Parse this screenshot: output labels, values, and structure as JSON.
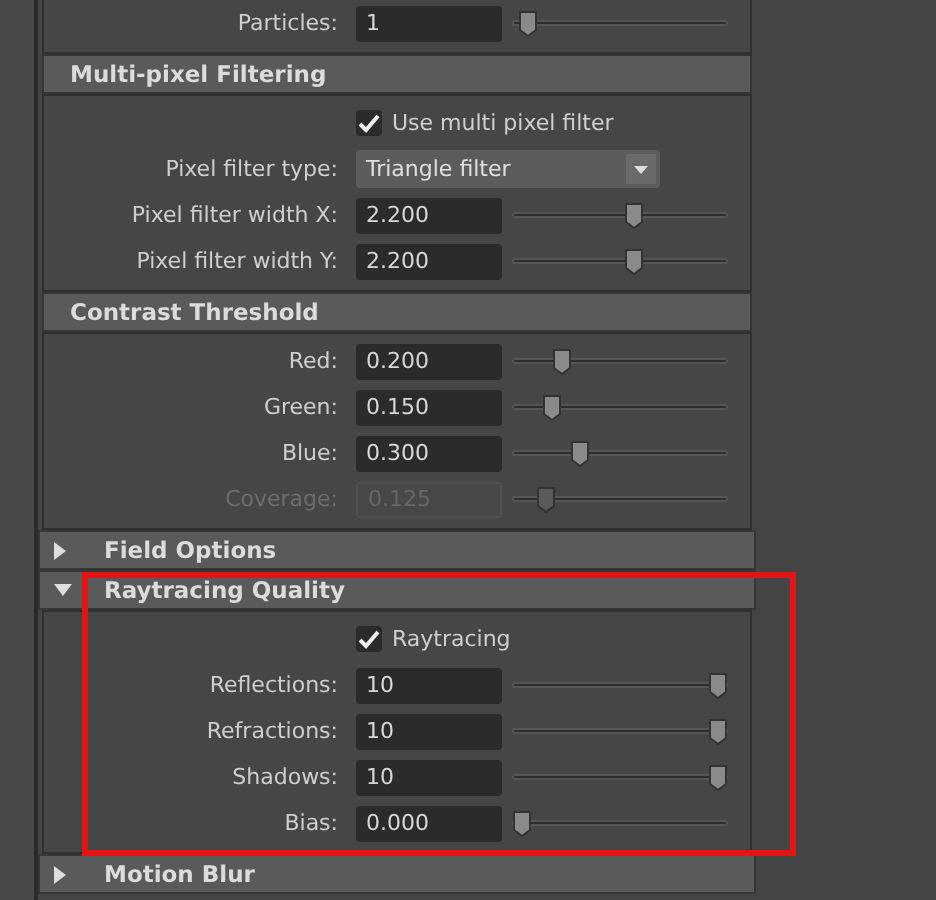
{
  "sections": [
    {
      "kind": "subsection",
      "rows": [
        {
          "kind": "slider",
          "label": "Particles:",
          "value": "1",
          "level": 0.03,
          "disabled": false
        }
      ]
    },
    {
      "kind": "subsection",
      "title": "Multi-pixel Filtering",
      "rows": [
        {
          "kind": "checkbox",
          "label": "Use multi pixel filter",
          "checked": true
        },
        {
          "kind": "dropdown",
          "label": "Pixel filter type:",
          "value": "Triangle filter"
        },
        {
          "kind": "slider",
          "label": "Pixel filter width X:",
          "value": "2.200",
          "level": 0.57,
          "disabled": false
        },
        {
          "kind": "slider",
          "label": "Pixel filter width Y:",
          "value": "2.200",
          "level": 0.57,
          "disabled": false
        }
      ]
    },
    {
      "kind": "subsection",
      "title": "Contrast Threshold",
      "rows": [
        {
          "kind": "slider",
          "label": "Red:",
          "value": "0.200",
          "level": 0.2,
          "disabled": false
        },
        {
          "kind": "slider",
          "label": "Green:",
          "value": "0.150",
          "level": 0.15,
          "disabled": false
        },
        {
          "kind": "slider",
          "label": "Blue:",
          "value": "0.300",
          "level": 0.3,
          "disabled": false
        },
        {
          "kind": "slider",
          "label": "Coverage:",
          "value": "0.125",
          "level": 0.125,
          "disabled": true
        }
      ]
    },
    {
      "kind": "section",
      "title": "Field Options",
      "expanded": false,
      "highlighted": false
    },
    {
      "kind": "section",
      "title": "Raytracing Quality",
      "expanded": true,
      "highlighted": true,
      "rows": [
        {
          "kind": "checkbox",
          "label": "Raytracing",
          "checked": true
        },
        {
          "kind": "slider",
          "label": "Reflections:",
          "value": "10",
          "level": 1,
          "disabled": false
        },
        {
          "kind": "slider",
          "label": "Refractions:",
          "value": "10",
          "level": 1,
          "disabled": false
        },
        {
          "kind": "slider",
          "label": "Shadows:",
          "value": "10",
          "level": 1,
          "disabled": false
        },
        {
          "kind": "slider",
          "label": "Bias:",
          "value": "0.000",
          "level": 0,
          "disabled": false
        }
      ]
    },
    {
      "kind": "section",
      "title": "Motion Blur",
      "expanded": false,
      "highlighted": false
    }
  ]
}
